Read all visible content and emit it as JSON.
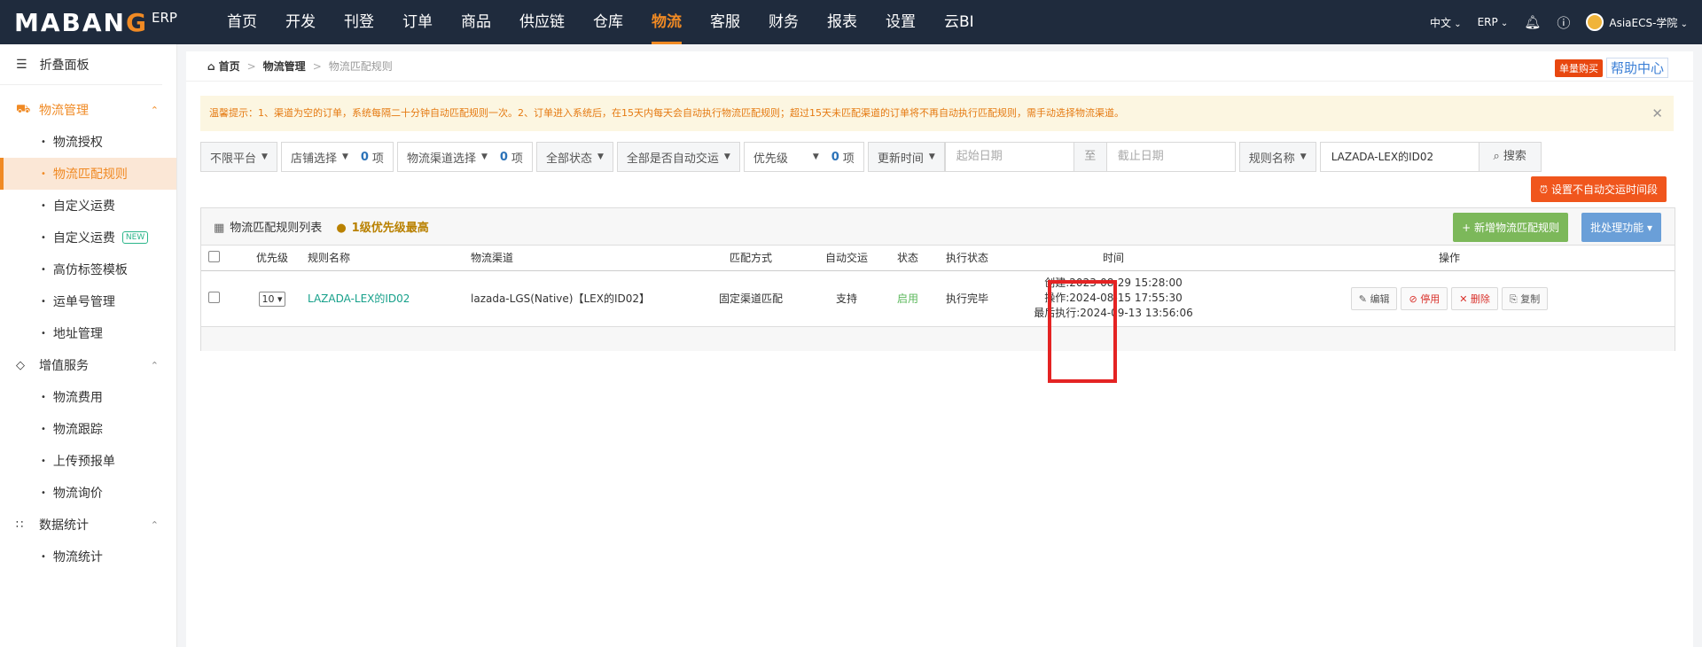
{
  "topbar": {
    "brand_left": "MABAN",
    "brand_o": "G",
    "erp": "ERP",
    "nav": [
      "首页",
      "开发",
      "刊登",
      "订单",
      "商品",
      "供应链",
      "仓库",
      "物流",
      "客服",
      "财务",
      "报表",
      "设置",
      "云BI"
    ],
    "active_nav": "物流",
    "lang": "中文",
    "erp_menu": "ERP",
    "user": "AsiaECS-学院"
  },
  "sidebar": {
    "fold": "折叠面板",
    "groups": [
      {
        "label": "物流管理",
        "items": [
          "物流授权",
          "物流匹配规则",
          "自定义运费",
          "自定义运费",
          "高仿标签模板",
          "运单号管理",
          "地址管理"
        ]
      },
      {
        "label": "增值服务",
        "items": [
          "物流费用",
          "物流跟踪",
          "上传预报单",
          "物流询价"
        ]
      },
      {
        "label": "数据统计",
        "items": [
          "物流统计"
        ]
      }
    ],
    "new_badge": "NEW"
  },
  "breadcrumb": {
    "home": "首页",
    "level1": "物流管理",
    "current": "物流匹配规则"
  },
  "top_buttons": {
    "buy": "单量购买",
    "help": "帮助中心"
  },
  "tip": "温馨提示：1、渠道为空的订单，系统每隔二十分钟自动匹配规则一次。2、订单进入系统后，在15天内每天会自动执行物流匹配规则；超过15天未匹配渠道的订单将不再自动执行匹配规则，需手动选择物流渠道。",
  "filters": {
    "platform": "不限平台",
    "shop": "店铺选择",
    "shop_count": "0",
    "unit": "项",
    "channel": "物流渠道选择",
    "channel_count": "0",
    "status": "全部状态",
    "auto": "全部是否自动交运",
    "priority": "优先级",
    "priority_count": "0",
    "time": "更新时间",
    "start_placeholder": "起始日期",
    "to": "至",
    "end_placeholder": "截止日期",
    "name_field": "规则名称",
    "search_value": "LAZADA-LEX的ID02",
    "search": "搜索"
  },
  "set_time_button": "设置不自动交运时间段",
  "panel": {
    "title": "物流匹配规则列表",
    "priority_note": "1级优先级最高",
    "add_button": "新增物流匹配规则",
    "batch_button": "批处理功能"
  },
  "table": {
    "headers": [
      "优先级",
      "规则名称",
      "物流渠道",
      "匹配方式",
      "自动交运",
      "状态",
      "执行状态",
      "时间",
      "操作"
    ],
    "rows": [
      {
        "priority": "10",
        "name": "LAZADA-LEX的ID02",
        "channel": "lazada-LGS(Native)【LEX的ID02】",
        "match": "固定渠道匹配",
        "auto": "支持",
        "status": "启用",
        "exec": "执行完毕",
        "created": "创建:2023-08-29 15:28:00",
        "operated": "操作:2024-08-15 17:55:30",
        "last_exec": "最后执行:2024-09-13 13:56:06",
        "ops": [
          "编辑",
          "停用",
          "删除",
          "复制"
        ]
      }
    ]
  }
}
